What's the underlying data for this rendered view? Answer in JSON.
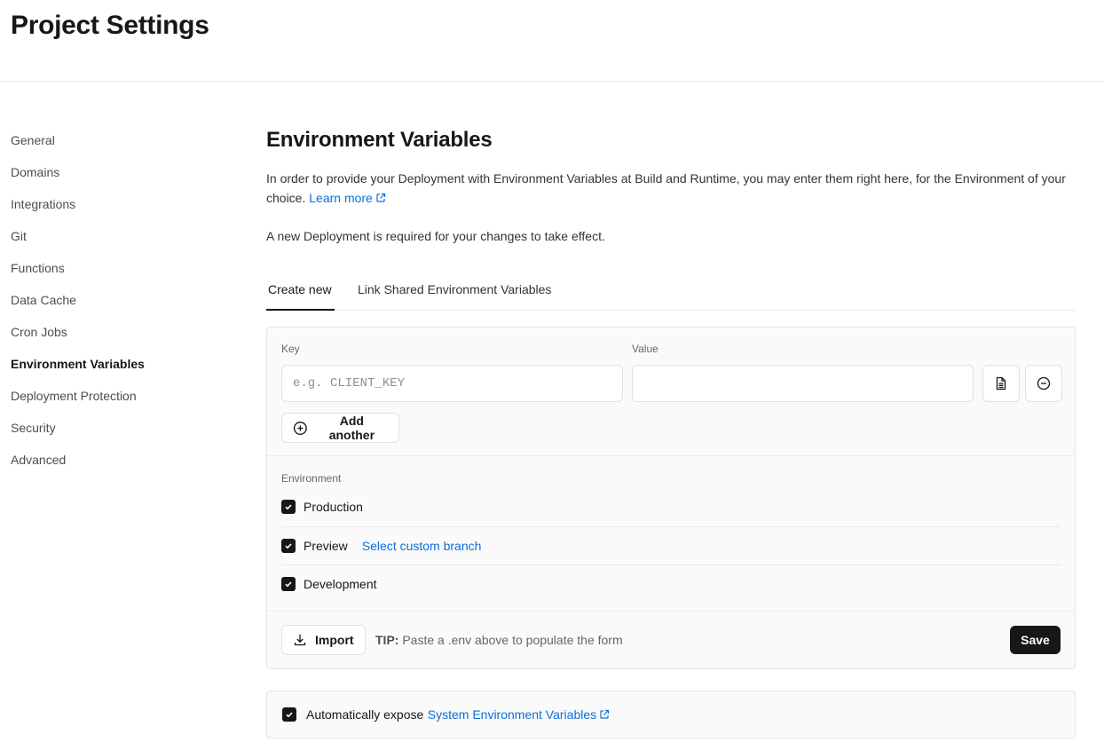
{
  "page": {
    "title": "Project Settings"
  },
  "sidebar": {
    "items": [
      {
        "label": "General"
      },
      {
        "label": "Domains"
      },
      {
        "label": "Integrations"
      },
      {
        "label": "Git"
      },
      {
        "label": "Functions"
      },
      {
        "label": "Data Cache"
      },
      {
        "label": "Cron Jobs"
      },
      {
        "label": "Environment Variables",
        "active": true
      },
      {
        "label": "Deployment Protection"
      },
      {
        "label": "Security"
      },
      {
        "label": "Advanced"
      }
    ]
  },
  "main": {
    "title": "Environment Variables",
    "description": "In order to provide your Deployment with Environment Variables at Build and Runtime, you may enter them right here, for the Environment of your choice.",
    "learn_more": "Learn more",
    "note": "A new Deployment is required for your changes to take effect.",
    "tabs": [
      {
        "label": "Create new",
        "active": true
      },
      {
        "label": "Link Shared Environment Variables"
      }
    ],
    "form": {
      "key_label": "Key",
      "key_placeholder": "e.g. CLIENT_KEY",
      "key_value": "",
      "value_label": "Value",
      "value_value": "",
      "add_another": "Add another",
      "env_label": "Environment",
      "environments": [
        {
          "label": "Production",
          "checked": true
        },
        {
          "label": "Preview",
          "checked": true,
          "link": "Select custom branch"
        },
        {
          "label": "Development",
          "checked": true
        }
      ],
      "import_label": "Import",
      "tip_prefix": "TIP:",
      "tip_text": "Paste a .env above to populate the form",
      "save_label": "Save"
    },
    "expose": {
      "checked": true,
      "prefix": "Automatically expose",
      "link": "System Environment Variables"
    }
  },
  "colors": {
    "accent_link": "#0a6fd8",
    "primary_button": "#171717"
  },
  "icons": [
    "external-link-icon",
    "file-icon",
    "remove-circle-icon",
    "plus-circle-icon",
    "checkmark-icon",
    "download-icon"
  ]
}
